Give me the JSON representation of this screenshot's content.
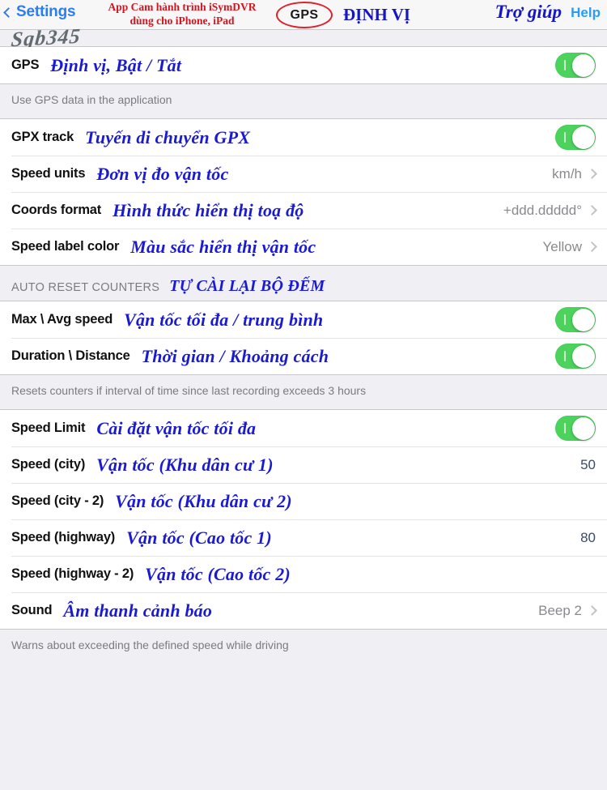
{
  "navbar": {
    "back_label": "Settings",
    "back_icon": "chevron-left-icon",
    "help_label": "Help",
    "help_annotation": "Trợ giúp",
    "red_annotation_line1": "App Cam hành trình iSymDVR",
    "red_annotation_line2": "dùng cho iPhone, iPad",
    "gps_badge": "GPS",
    "gps_annotation": "ĐỊNH VỊ",
    "signature": "Sgb345"
  },
  "section_gps": {
    "rows": [
      {
        "label": "GPS",
        "annotation": "Định vị, Bật / Tắt",
        "control": "toggle",
        "toggle_on": true
      }
    ],
    "footer": "Use GPS data in the application"
  },
  "section_track": {
    "rows": [
      {
        "label": "GPX track",
        "annotation": "Tuyến di chuyển GPX",
        "control": "toggle",
        "toggle_on": true
      },
      {
        "label": "Speed units",
        "annotation": "Đơn vị đo vận tốc",
        "control": "value",
        "value": "km/h"
      },
      {
        "label": "Coords format",
        "annotation": "Hình thức hiển thị toạ độ",
        "control": "value",
        "value": "+ddd.ddddd°"
      },
      {
        "label": "Speed label color",
        "annotation": "Màu sắc hiển thị vận tốc",
        "control": "value",
        "value": "Yellow"
      }
    ]
  },
  "section_autoreset": {
    "header": "AUTO RESET COUNTERS",
    "header_annotation": "TỰ CÀI LẠI BỘ ĐẾM",
    "rows": [
      {
        "label": "Max \\ Avg speed",
        "annotation": "Vận tốc tối đa / trung bình",
        "control": "toggle",
        "toggle_on": true
      },
      {
        "label": "Duration \\ Distance",
        "annotation": "Thời gian / Khoảng cách",
        "control": "toggle",
        "toggle_on": true
      }
    ],
    "footer": "Resets counters if interval of time since last recording exceeds 3 hours"
  },
  "section_speedlimit": {
    "rows": [
      {
        "label": "Speed Limit",
        "annotation": "Cài đặt vận tốc tối đa",
        "control": "toggle",
        "toggle_on": true
      },
      {
        "label": "Speed (city)",
        "annotation": "Vận tốc (Khu dân cư 1)",
        "control": "number",
        "value": "50"
      },
      {
        "label": "Speed (city - 2)",
        "annotation": "Vận tốc (Khu dân cư 2)",
        "control": "none",
        "value": ""
      },
      {
        "label": "Speed (highway)",
        "annotation": "Vận tốc (Cao tốc 1)",
        "control": "number",
        "value": "80"
      },
      {
        "label": "Speed (highway - 2)",
        "annotation": "Vận tốc (Cao tốc 2)",
        "control": "none",
        "value": ""
      },
      {
        "label": "Sound",
        "annotation": "Âm thanh cảnh báo",
        "control": "value",
        "value": "Beep 2"
      }
    ],
    "footer": "Warns about exceeding the defined speed while driving"
  },
  "colors": {
    "toggle_on": "#4CD35C",
    "accent_blue": "#2E7DEF",
    "annotation_blue": "#1A1AD2",
    "annotation_red": "#D4141E",
    "background": "#EFEFF4"
  }
}
